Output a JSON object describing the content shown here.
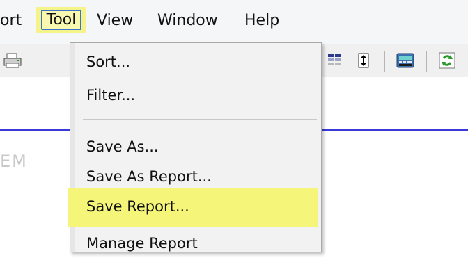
{
  "menubar": {
    "items": [
      {
        "label": "ort"
      },
      {
        "label": "Tool"
      },
      {
        "label": "View"
      },
      {
        "label": "Window"
      },
      {
        "label": "Help"
      }
    ]
  },
  "toolbar": {
    "icons": [
      "print-icon",
      "grid-icon",
      "fit-height-icon",
      "calculator-icon",
      "refresh-icon"
    ]
  },
  "tool_menu": {
    "items": [
      {
        "label": "Sort..."
      },
      {
        "label": "Filter..."
      },
      {
        "label": "Save As..."
      },
      {
        "label": "Save As Report..."
      },
      {
        "label": "Save Report..."
      },
      {
        "label": "Manage Report"
      }
    ],
    "highlighted": "Save Report..."
  },
  "content": {
    "ghost_text": "EM"
  },
  "colors": {
    "highlight": "#f5f57a",
    "focus_border": "#3c74c9",
    "divider": "#3a3ad8"
  }
}
